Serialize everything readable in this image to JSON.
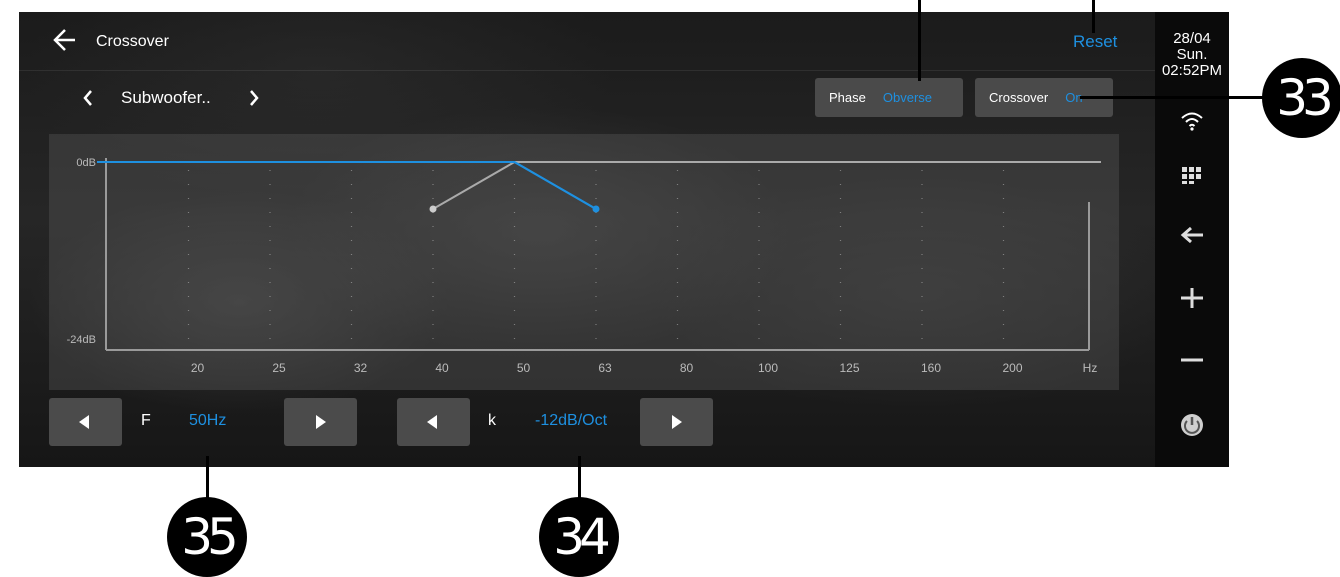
{
  "header": {
    "title": "Crossover",
    "reset_label": "Reset"
  },
  "channel": {
    "name": "Subwoofer.."
  },
  "phase": {
    "label": "Phase",
    "value": "Obverse"
  },
  "crossover_toggle": {
    "label": "Crossover",
    "value": "On"
  },
  "controls": {
    "frequency": {
      "label": "F",
      "value": "50Hz"
    },
    "slope": {
      "label": "k",
      "value": "-12dB/Oct"
    }
  },
  "status": {
    "date": "28/04",
    "day": "Sun.",
    "time": "02:52PM"
  },
  "side_icons": [
    "wifi-icon",
    "apps-grid-icon",
    "back-arrow-icon",
    "volume-up-icon",
    "volume-down-icon",
    "power-icon"
  ],
  "callouts": [
    "33",
    "34",
    "35"
  ],
  "colors": {
    "accent": "#1e90e0",
    "panel": "#4a4a4a",
    "sidebar": "#0a0a0a"
  },
  "chart_data": {
    "type": "line",
    "ylabel_top": "0dB",
    "ylabel_bottom": "-24dB",
    "x_unit": "Hz",
    "x": [
      "20",
      "25",
      "32",
      "40",
      "50",
      "63",
      "80",
      "100",
      "125",
      "160",
      "200"
    ],
    "ylim": [
      -24,
      0
    ],
    "series": [
      {
        "color": "#1e90e0",
        "points": [
          [
            "20",
            0
          ],
          [
            "50",
            0
          ],
          [
            "63",
            -6
          ]
        ]
      },
      {
        "color": "#aaaaaa",
        "points": [
          [
            "40",
            -6
          ],
          [
            "50",
            0
          ],
          [
            "200+",
            0
          ]
        ]
      }
    ]
  }
}
